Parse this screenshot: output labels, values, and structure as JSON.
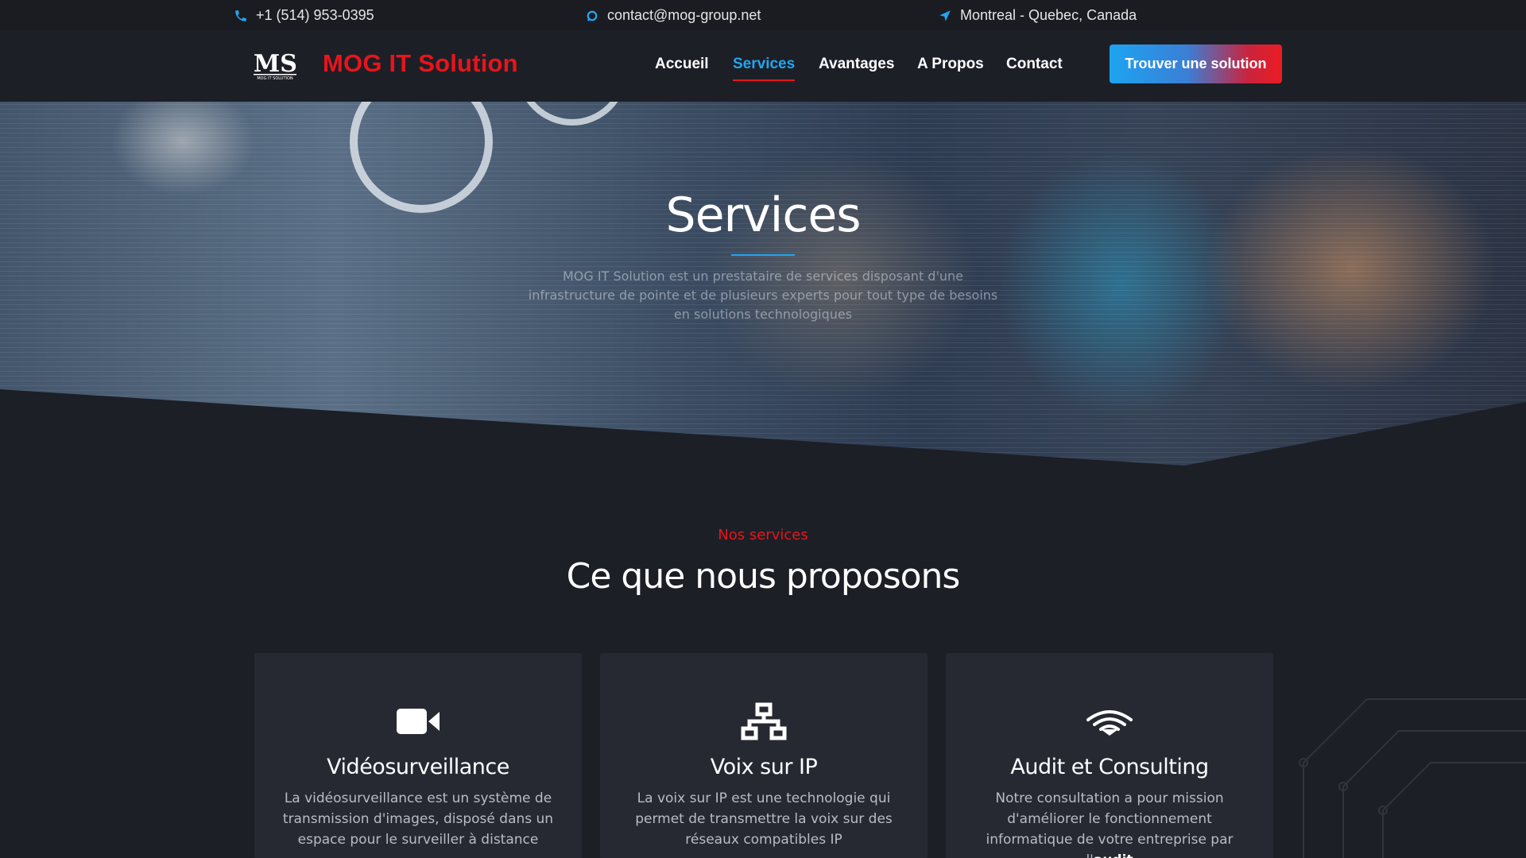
{
  "topbar": {
    "phone": "+1 (514) 953-0395",
    "email": "contact@mog-group.net",
    "location": "Montreal - Quebec, Canada"
  },
  "header": {
    "logo_text": "MS",
    "logo_subtext": "MOG IT SOLUTION",
    "brand": "MOG IT Solution",
    "nav": [
      {
        "label": "Accueil",
        "active": false
      },
      {
        "label": "Services",
        "active": true
      },
      {
        "label": "Avantages",
        "active": false
      },
      {
        "label": "A Propos",
        "active": false
      },
      {
        "label": "Contact",
        "active": false
      }
    ],
    "cta_label": "Trouver une solution"
  },
  "hero": {
    "title": "Services",
    "subtitle": "MOG IT Solution est un prestataire de services disposant d'une infrastructure de pointe et de plusieurs experts pour tout type de besoins en solutions technologiques"
  },
  "services": {
    "eyebrow": "Nos services",
    "title": "Ce que nous proposons",
    "cards": [
      {
        "icon": "video-camera-icon",
        "title": "Vidéosurveillance",
        "text": "La vidéosurveillance est un système de transmission d'images, disposé dans un espace pour le surveiller à distance"
      },
      {
        "icon": "network-icon",
        "title": "Voix sur IP",
        "text": "La voix sur IP est une technologie qui permet de transmettre la voix sur des réseaux compatibles IP"
      },
      {
        "icon": "wifi-hand-icon",
        "title": "Audit et Consulting",
        "text_before": "Notre consultation a pour mission d'améliorer le fonctionnement informatique de votre entreprise par l'",
        "text_bold": "audit"
      }
    ]
  },
  "colors": {
    "accent_red": "#e8141b",
    "accent_blue": "#21a6f2",
    "background": "#1d1f26",
    "card": "#262932"
  }
}
